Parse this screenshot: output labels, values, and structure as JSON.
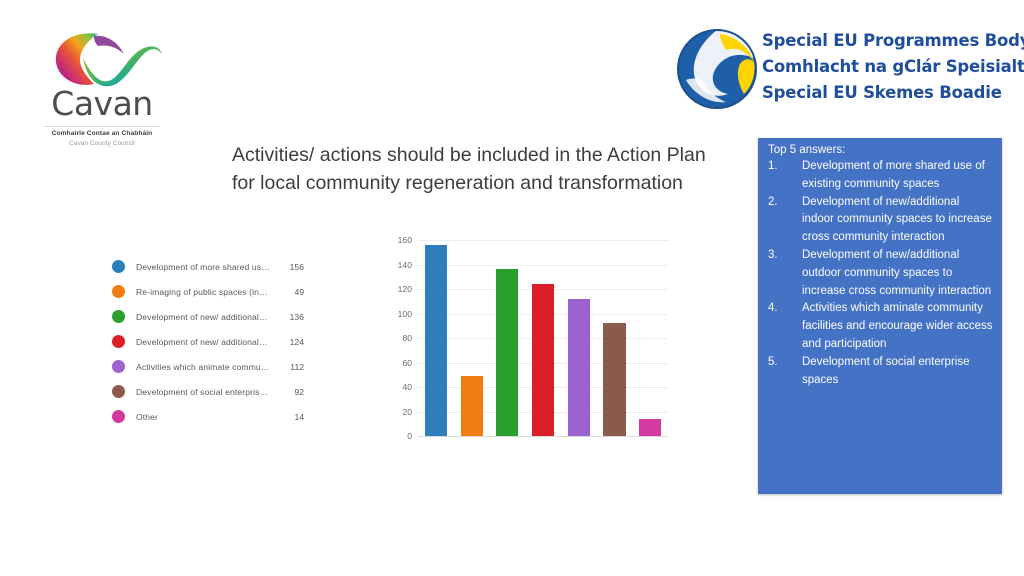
{
  "slide": {
    "title_line1": "Activities/ actions should be included in the Action Plan",
    "title_line2": "for local community regeneration and transformation"
  },
  "cavan_logo": {
    "wordmark": "Cavan",
    "sub_irish": "Comhairle Contae an Chabháin",
    "sub_english": "Cavan County Council",
    "icon": "cavan-swoosh-logo"
  },
  "seupb_logo": {
    "icon": "seupb-globe-logo",
    "line1": "Special EU Programmes Body",
    "line2": "Comhlacht na gClár Speisialta AE",
    "line3": "Special EU Skemes Boadie",
    "text_color": "#1f4e9c"
  },
  "legend": {
    "items": [
      {
        "color": "#2e7ebb",
        "label": "Development of more shared us…",
        "value": "156"
      },
      {
        "color": "#ef7d12",
        "label": "Re-imaging of public spaces (in…",
        "value": "49"
      },
      {
        "color": "#2ca02c",
        "label": "Development of new/ additional…",
        "value": "136"
      },
      {
        "color": "#dc1f26",
        "label": "Development of new/ additional…",
        "value": "124"
      },
      {
        "color": "#9b62d0",
        "label": "Activities which animate commu…",
        "value": "112"
      },
      {
        "color": "#8b5a4a",
        "label": "Development of social enterpris…",
        "value": "92"
      },
      {
        "color": "#d4399f",
        "label": "Other",
        "value": "14"
      }
    ]
  },
  "answers_panel": {
    "heading": "Top 5 answers:",
    "background": "#4472c4",
    "items": [
      {
        "num": "1.",
        "text": "Development of more shared use of existing community spaces"
      },
      {
        "num": "2.",
        "text": "Development  of new/additional indoor community spaces to increase cross community interaction"
      },
      {
        "num": "3.",
        "text": " Development  of new/additional outdoor community spaces to increase cross community interaction"
      },
      {
        "num": "4.",
        "text": "Activities which aminate community facilities and encourage wider access and participation"
      },
      {
        "num": "5.",
        "text": "Development of social enterprise spaces"
      }
    ]
  },
  "chart_data": {
    "type": "bar",
    "title": "",
    "xlabel": "",
    "ylabel": "",
    "ylim": [
      0,
      160
    ],
    "yticks": [
      "160",
      "140",
      "120",
      "100",
      "80",
      "60",
      "40",
      "20",
      "0"
    ],
    "grid": true,
    "legend_position": "left",
    "categories": [
      "Development of more shared use of existing community spaces",
      "Re-imaging of public spaces (including…)",
      "Development of new/ additional indoor community spaces",
      "Development of new/ additional outdoor community spaces",
      "Activities which animate community facilities",
      "Development of social enterprise spaces",
      "Other"
    ],
    "values": [
      156,
      49,
      136,
      124,
      112,
      92,
      14
    ],
    "colors": [
      "#2e7ebb",
      "#ef7d12",
      "#2ca02c",
      "#dc1f26",
      "#9b62d0",
      "#8b5a4a",
      "#d4399f"
    ]
  }
}
